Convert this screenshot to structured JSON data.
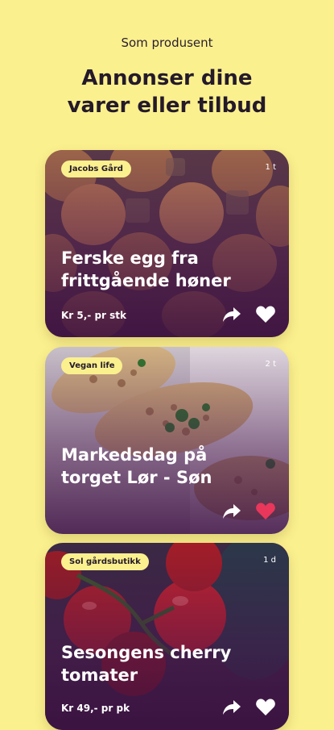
{
  "header": {
    "subtitle": "Som produsent",
    "headline_line1": "Annonser dine",
    "headline_line2": "varer eller tilbud"
  },
  "cards": [
    {
      "tag": "Jacobs Gård",
      "time": "1 t",
      "title_line1": "Ferske egg fra",
      "title_line2": "frittgående høner",
      "price": "Kr 5,- pr stk",
      "liked": false,
      "image": "brown-eggs-in-tray"
    },
    {
      "tag": "Vegan life",
      "time": "2 t",
      "title_line1": "Markedsdag på",
      "title_line2": "torget Lør - Søn",
      "price": "",
      "liked": true,
      "image": "vegan-tacos"
    },
    {
      "tag": "Sol gårdsbutikk",
      "time": "1 d",
      "title_line1": "Sesongens cherry",
      "title_line2": "tomater",
      "price": "Kr 49,- pr pk",
      "liked": false,
      "image": "cherry-tomatoes-on-vine"
    }
  ],
  "colors": {
    "background": "#fbf08e",
    "tag_background": "#fbf08e",
    "heading_text": "#241a2a",
    "liked_heart": "#e8375a",
    "icon_white": "#ffffff"
  }
}
